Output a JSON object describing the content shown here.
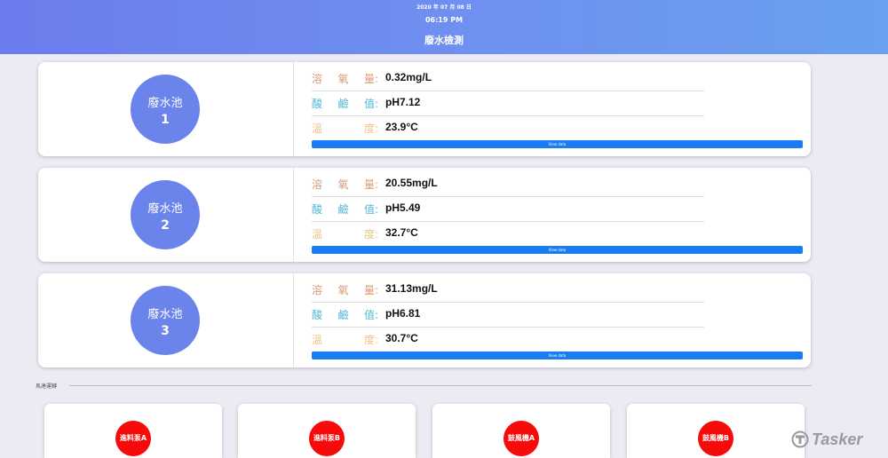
{
  "header": {
    "date": "2020 年 07 月 08 日",
    "time": "06:19 PM",
    "title": "廢水檢測"
  },
  "labels": {
    "do": [
      "溶",
      "氧",
      "量:"
    ],
    "ph": [
      "酸",
      "鹼",
      "值:"
    ],
    "temp": [
      "溫",
      "度:"
    ]
  },
  "ponds": [
    {
      "name": "廢水池",
      "number": "1",
      "do": "0.32mg/L",
      "ph": "pH7.12",
      "temp": "23.9°C",
      "button": "View data"
    },
    {
      "name": "廢水池",
      "number": "2",
      "do": "20.55mg/L",
      "ph": "pH5.49",
      "temp": "32.7°C",
      "button": "View data"
    },
    {
      "name": "廢水池",
      "number": "3",
      "do": "31.13mg/L",
      "ph": "pH6.81",
      "temp": "30.7°C",
      "button": "View data"
    }
  ],
  "quick_control": {
    "label": "馬達運轉",
    "devices": [
      "進料泵A",
      "進料泵B",
      "鼓風機A",
      "鼓風機B"
    ]
  },
  "watermark": "Tasker",
  "colors": {
    "accent": "#6b84ec",
    "button": "#1a7cf2",
    "device": "#f60a0a"
  }
}
